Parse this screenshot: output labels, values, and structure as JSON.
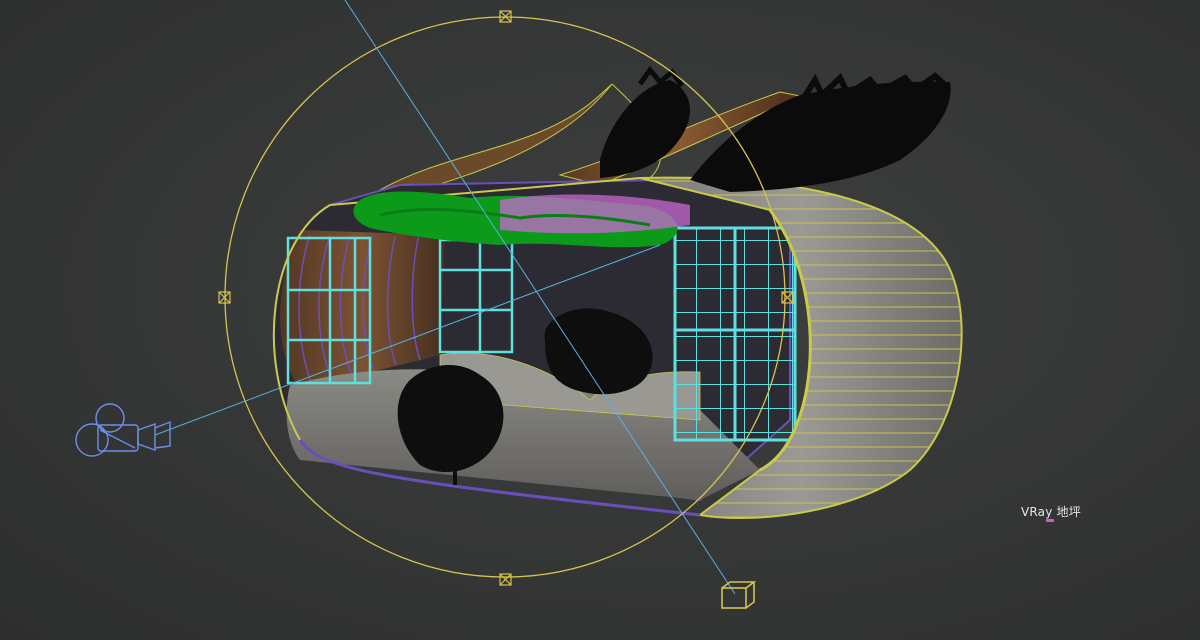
{
  "viewport": {
    "object_label": "VRay 地坪",
    "colors": {
      "background": "#363737",
      "selection_gizmo": "#d8c250",
      "target_line": "#5ab0e0",
      "camera_wire": "#6f8ee8",
      "window_frames": "#5fe0e0",
      "foliage_canopy": "#0c9a1a",
      "foliage_dark": "#0b0b0b",
      "flower_pink": "#c868d2",
      "shell_wire": "#c9c94a",
      "inner_purple": "#6a4fb8",
      "wood": "#8a5a32",
      "concrete": "#8d8b86",
      "floor_marker": "#d65acb"
    },
    "icons": [
      "camera-icon",
      "target-box-icon",
      "gizmo-handle-icon"
    ]
  }
}
